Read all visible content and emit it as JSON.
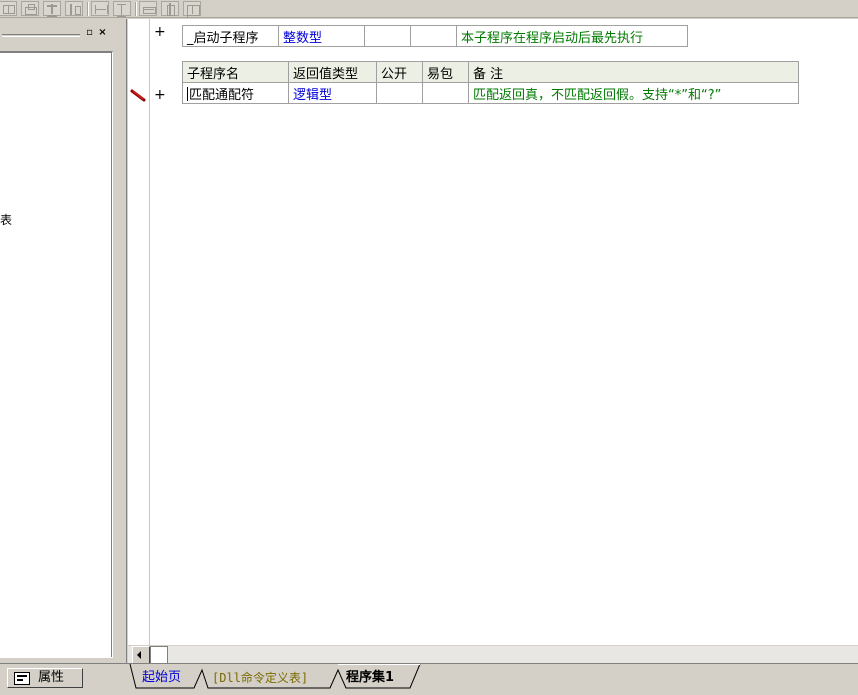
{
  "left_panel": {
    "minimize_glyph": "▫",
    "close_glyph": "×",
    "tree_fragment": "表"
  },
  "startup_table": {
    "plus": "+",
    "name": "_启动子程序",
    "return_type": "整数型",
    "public": "",
    "easy_pack": "",
    "comment": "本子程序在程序启动后最先执行"
  },
  "sub_table": {
    "headers": {
      "name": "子程序名",
      "return_type": "返回值类型",
      "public": "公开",
      "easy_pack": "易包",
      "comment": "备 注"
    },
    "row": {
      "plus": "+",
      "name": "匹配通配符",
      "return_type": "逻辑型",
      "public": "",
      "easy_pack": "",
      "comment": "匹配返回真，不匹配返回假。支持“*”和“?”"
    }
  },
  "bottom_tabs": {
    "properties": "属性",
    "start_page": "起始页",
    "dll_tab": "[Dll命令定义表]",
    "program_set": "程序集1"
  },
  "colors": {
    "type_blue": "#0000d8",
    "comment_green": "#007a00",
    "header_bg": "#ecf0e4",
    "pencil_red": "#c00000"
  }
}
